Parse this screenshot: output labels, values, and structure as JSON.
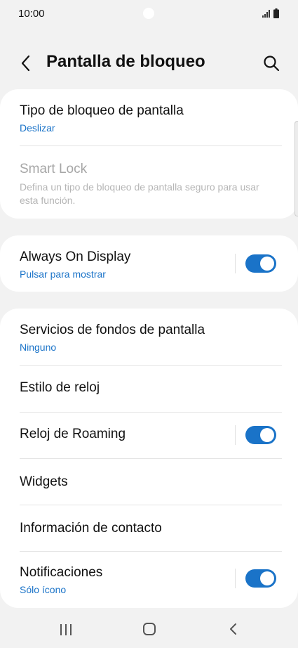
{
  "status_bar": {
    "time": "10:00",
    "icons": [
      "signal-icon",
      "battery-icon"
    ]
  },
  "app_bar": {
    "title": "Pantalla de bloqueo",
    "icons": [
      "back-icon",
      "search-icon"
    ]
  },
  "sections": {
    "security": {
      "lock_type": {
        "title": "Tipo de bloqueo de pantalla",
        "value": "Deslizar"
      },
      "smart_lock": {
        "title": "Smart Lock",
        "description": "Defina un tipo de bloqueo de pantalla seguro para usar esta función."
      }
    },
    "aod": {
      "title": "Always On Display",
      "value": "Pulsar para mostrar",
      "toggle_on": true
    },
    "display": {
      "wallpaper_services": {
        "title": "Servicios de fondos de pantalla",
        "value": "Ninguno"
      },
      "clock_style": {
        "title": "Estilo de reloj"
      },
      "roaming_clock": {
        "title": "Reloj de Roaming",
        "toggle_on": true
      },
      "widgets": {
        "title": "Widgets"
      },
      "contact_info": {
        "title": "Información de contacto"
      },
      "notifications": {
        "title": "Notificaciones",
        "value": "Sólo ícono",
        "toggle_on": true
      }
    }
  },
  "nav_bar": {
    "icons": [
      "recent-apps-icon",
      "home-icon",
      "back-icon"
    ]
  },
  "colors": {
    "accent": "#1a73c8",
    "background": "#f2f2f2",
    "card": "#ffffff",
    "disabled_text": "#a6a6a6"
  }
}
